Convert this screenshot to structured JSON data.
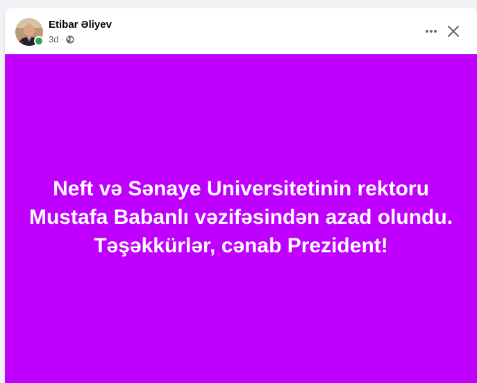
{
  "post": {
    "author": {
      "name": "Etibar Əliyev",
      "online": true
    },
    "timestamp": "3d",
    "separator": "·",
    "audience_icon": "globe-icon",
    "menu_icon": "more-options-icon",
    "close_icon": "close-icon",
    "background_color": "#c000ff",
    "text_lines": [
      "Neft və Sənaye Universitetinin rektoru",
      "Mustafa Babanlı vəzifəsindən azad olundu.",
      "Təşəkkürlər, cənab Prezident!"
    ]
  }
}
